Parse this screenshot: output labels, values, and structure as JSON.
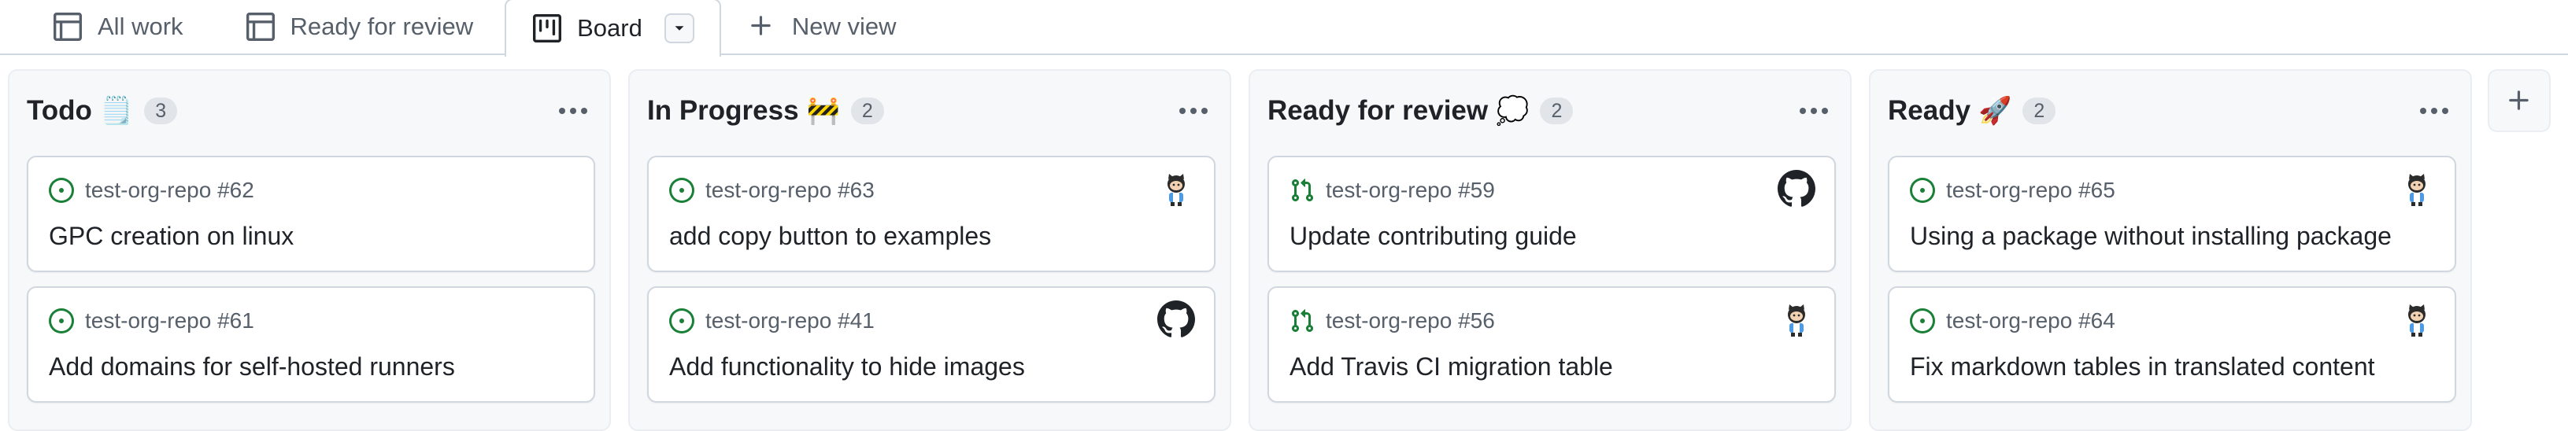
{
  "tabs": [
    {
      "label": "All work",
      "icon": "table-icon"
    },
    {
      "label": "Ready for review",
      "icon": "table-icon"
    },
    {
      "label": "Board",
      "icon": "board-icon",
      "active": true
    },
    {
      "label": "New view",
      "icon": "plus-icon"
    }
  ],
  "columns": [
    {
      "title": "Todo",
      "emoji": "🗒️",
      "count": "3",
      "cards": [
        {
          "repo": "test-org-repo #62",
          "title": "GPC creation on linux",
          "status": "open-issue-icon",
          "avatar": ""
        },
        {
          "repo": "test-org-repo #61",
          "title": "Add domains for self-hosted runners",
          "status": "open-issue-icon",
          "avatar": ""
        }
      ]
    },
    {
      "title": "In Progress",
      "emoji": "🚧",
      "count": "2",
      "cards": [
        {
          "repo": "test-org-repo #63",
          "title": "add copy button to examples",
          "status": "open-issue-icon",
          "avatar": "octocat-avatar"
        },
        {
          "repo": "test-org-repo #41",
          "title": "Add functionality to hide images",
          "status": "open-issue-icon",
          "avatar": "github-avatar"
        }
      ]
    },
    {
      "title": "Ready for review",
      "emoji": "💭",
      "count": "2",
      "cards": [
        {
          "repo": "test-org-repo #59",
          "title": "Update contributing guide",
          "status": "pull-request-icon",
          "avatar": "github-avatar"
        },
        {
          "repo": "test-org-repo #56",
          "title": "Add Travis CI migration table",
          "status": "pull-request-icon",
          "avatar": "octocat-avatar"
        }
      ]
    },
    {
      "title": "Ready",
      "emoji": "🚀",
      "count": "2",
      "cards": [
        {
          "repo": "test-org-repo #65",
          "title": "Using a package without installing package",
          "status": "open-issue-icon",
          "avatar": "octocat-avatar"
        },
        {
          "repo": "test-org-repo #64",
          "title": "Fix markdown tables in translated content",
          "status": "open-issue-icon",
          "avatar": "octocat-avatar"
        }
      ]
    }
  ],
  "colors": {
    "open": "#1a7f37",
    "text_muted": "#57606a",
    "border": "#d0d7de",
    "column_bg": "#f6f8fa"
  }
}
